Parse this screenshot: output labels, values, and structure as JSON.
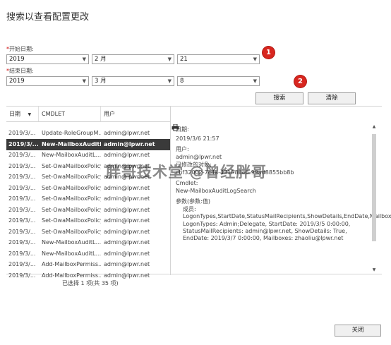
{
  "page": {
    "title": "搜索以查看配置更改"
  },
  "start": {
    "label": "开始日期:",
    "required": "*",
    "year": "2019",
    "month": "2 月",
    "day": "21"
  },
  "end": {
    "label": "结束日期:",
    "required": "*",
    "year": "2019",
    "month": "3 月",
    "day": "8"
  },
  "badges": {
    "b1": "1",
    "b2": "2"
  },
  "buttons": {
    "search": "搜索",
    "clear": "清除",
    "close": "关闭"
  },
  "table": {
    "headers": {
      "date": "日期",
      "cmdlet": "CMDLET",
      "user": "用户"
    },
    "rows": [
      {
        "date": "2019/3/...",
        "cmdlet": "Update-RoleGroupM...",
        "user": "admin@lpwr.net"
      },
      {
        "date": "2019/3/...",
        "cmdlet": "New-MailboxAuditL...",
        "user": "admin@lpwr.net"
      },
      {
        "date": "2019/3/...",
        "cmdlet": "New-MailboxAuditL...",
        "user": "admin@lpwr.net"
      },
      {
        "date": "2019/3/...",
        "cmdlet": "Set-OwaMailboxPolicy",
        "user": "admin@lpwr.net"
      },
      {
        "date": "2019/3/...",
        "cmdlet": "Set-OwaMailboxPolicy",
        "user": "admin@lpwr.net"
      },
      {
        "date": "2019/3/...",
        "cmdlet": "Set-OwaMailboxPolicy",
        "user": "admin@lpwr.net"
      },
      {
        "date": "2019/3/...",
        "cmdlet": "Set-OwaMailboxPolicy",
        "user": "admin@lpwr.net"
      },
      {
        "date": "2019/3/...",
        "cmdlet": "Set-OwaMailboxPolicy",
        "user": "admin@lpwr.net"
      },
      {
        "date": "2019/3/...",
        "cmdlet": "Set-OwaMailboxPolicy",
        "user": "admin@lpwr.net"
      },
      {
        "date": "2019/3/...",
        "cmdlet": "Set-OwaMailboxPolicy",
        "user": "admin@lpwr.net"
      },
      {
        "date": "2019/3/...",
        "cmdlet": "New-MailboxAuditL...",
        "user": "admin@lpwr.net"
      },
      {
        "date": "2019/3/...",
        "cmdlet": "New-MailboxAuditL...",
        "user": "admin@lpwr.net"
      },
      {
        "date": "2019/3/...",
        "cmdlet": "Add-MailboxPermiss...",
        "user": "admin@lpwr.net"
      },
      {
        "date": "2019/3/...",
        "cmdlet": "Add-MailboxPermiss...",
        "user": "admin@lpwr.net"
      }
    ]
  },
  "detail": {
    "date_label": "日期:",
    "date_value": "2019/3/6 21:57",
    "user_label": "用户:",
    "user_value": "admin@lpwr.net",
    "object_label": "已修改的对象:",
    "object_value": "cbf32002-7c4a-431f-85e6-99ad8855bb8b",
    "cmdlet_label": "Cmdlet:",
    "cmdlet_value": "New-MailboxAuditLogSearch",
    "params_label": "参数(参数:值)",
    "param1": "成员: LogonTypes,StartDate,StatusMailRecipients,ShowDetails,EndDate,Mailboxes",
    "param2": "LogonTypes: Admin;Delegate, StartDate: 2019/3/5 0:00:00, StatusMailRecipients: admin@lpwr.net, ShowDetails: True, EndDate: 2019/3/7 0:00:00, Mailboxes: zhaoliu@lpwr.net"
  },
  "status": "已选择 1 项(共 35 项)",
  "watermark": "胖哥技术堂 @曾经胖哥"
}
